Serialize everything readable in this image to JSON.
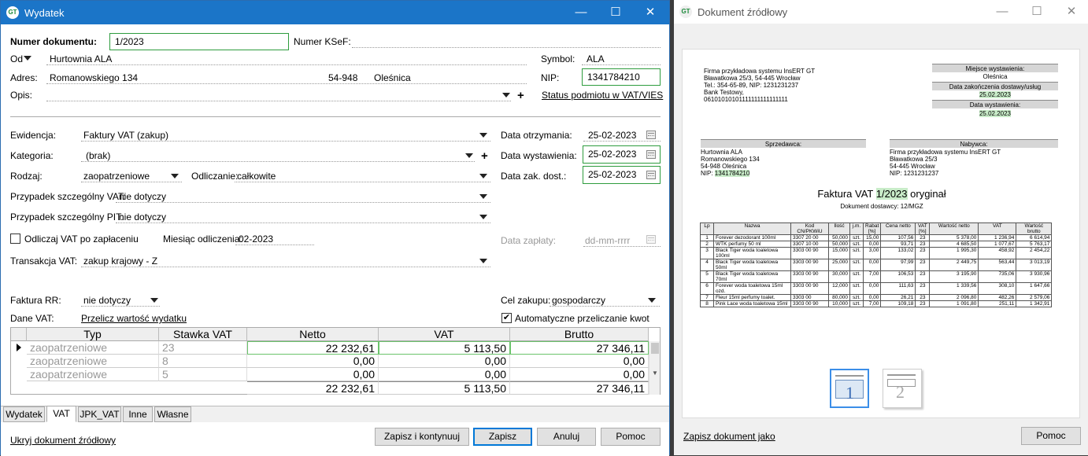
{
  "win1": {
    "title": "Wydatek",
    "minimize": "—",
    "maximize": "☐",
    "close": "✕"
  },
  "form": {
    "numer_label": "Numer dokumentu:",
    "numer": "1/2023",
    "ksef_label": "Numer KSeF:",
    "ksef": "",
    "od_label": "Od",
    "od": "Hurtownia ALA",
    "symbol_label": "Symbol:",
    "symbol": "ALA",
    "adres_label": "Adres:",
    "adres": "Romanowskiego 134",
    "kod": "54-948",
    "miasto": "Oleśnica",
    "nip_label": "NIP:",
    "nip": "1341784210",
    "opis_label": "Opis:",
    "opis": "",
    "status_link": "Status podmiotu w VAT/VIES",
    "ewidencja_label": "Ewidencja:",
    "ewidencja": "Faktury VAT (zakup)",
    "kategoria_label": "Kategoria:",
    "kategoria": "(brak)",
    "rodzaj_label": "Rodzaj:",
    "rodzaj": "zaopatrzeniowe",
    "odliczanie_label": "Odliczanie:",
    "odliczanie": "całkowite",
    "psvat_label": "Przypadek szczególny VAT:",
    "psvat": "nie dotyczy",
    "pspit_label": "Przypadek szczególny PIT:",
    "pspit": "nie dotyczy",
    "odliczaj_label": "Odliczaj VAT po zapłaceniu",
    "miesiac_label": "Miesiąc odliczenia:",
    "miesiac": "02-2023",
    "transakcja_label": "Transakcja VAT:",
    "transakcja": "zakup krajowy - Z",
    "data_otrz_label": "Data otrzymania:",
    "data_otrz": "25-02-2023",
    "data_wyst_label": "Data wystawienia:",
    "data_wyst": "25-02-2023",
    "data_zak_label": "Data zak. dost.:",
    "data_zak": "25-02-2023",
    "data_zap_label": "Data zapłaty:",
    "data_zap": "dd-mm-rrrr",
    "rr_label": "Faktura RR:",
    "rr": "nie dotyczy",
    "cel_label": "Cel zakupu:",
    "cel": "gospodarczy",
    "dane_vat_label": "Dane VAT:",
    "przelicz_link": "Przelicz wartość wydatku",
    "auto_label": "Automatyczne przeliczanie kwot",
    "auto_check": "✔"
  },
  "grid": {
    "headers": [
      "Typ",
      "Stawka VAT",
      "Netto",
      "VAT",
      "Brutto"
    ],
    "rows": [
      {
        "typ": "zaopatrzeniowe",
        "stawka": "23",
        "netto": "22 232,61",
        "vat": "5 113,50",
        "brutto": "27 346,11"
      },
      {
        "typ": "zaopatrzeniowe",
        "stawka": "8",
        "netto": "0,00",
        "vat": "0,00",
        "brutto": "0,00"
      },
      {
        "typ": "zaopatrzeniowe",
        "stawka": "5",
        "netto": "0,00",
        "vat": "0,00",
        "brutto": "0,00"
      }
    ],
    "sum": {
      "netto": "22 232,61",
      "vat": "5 113,50",
      "brutto": "27 346,11"
    }
  },
  "tabs": [
    "Wydatek",
    "VAT",
    "JPK_VAT",
    "Inne",
    "Własne"
  ],
  "footer": {
    "hide_link": "Ukryj dokument źródłowy",
    "btn_save_continue": "Zapisz i kontynuuj",
    "btn_save": "Zapisz",
    "btn_cancel": "Anuluj",
    "btn_help": "Pomoc"
  },
  "win2": {
    "title": "Dokument źródłowy",
    "save_link": "Zapisz dokument jako",
    "btn_help": "Pomoc"
  },
  "doc": {
    "firm": [
      "Firma przykładowa systemu InsERT GT",
      "Bławatkowa 25/3, 54-445 Wrocław",
      "Tel.: 354-65-89, NIP: 1231231237",
      "Bank Testowy,",
      "06101010101111111111111111"
    ],
    "place_h": "Miejsce wystawienia:",
    "place": "Oleśnica",
    "dz_h": "Data zakończenia dostawy/usług",
    "dz": "25.02.2023",
    "dw_h": "Data wystawienia:",
    "dw": "25.02.2023",
    "seller_h": "Sprzedawca:",
    "seller": [
      "Hurtownia ALA",
      "Romanowskiego 134",
      "54-948 Oleśnica"
    ],
    "seller_nip_label": "NIP:",
    "seller_nip": "1341784210",
    "buyer_h": "Nabywca:",
    "buyer": [
      "Firma przykładowa systemu InsERT GT",
      "Bławatkowa 25/3",
      "54-445 Wrocław",
      "NIP: 1231231237"
    ],
    "title_a": "Faktura VAT",
    "title_num": "1/2023",
    "title_b": "oryginał",
    "subtitle": "Dokument dostawcy: 12/MGZ",
    "cols": [
      "Lp",
      "Nazwa",
      "Kod CN/PKWiU",
      "Ilość",
      "j.m.",
      "Rabat [%]",
      "Cena netto",
      "VAT [%]",
      "Wartość netto",
      "VAT",
      "Wartość brutto"
    ],
    "items": [
      [
        "1",
        "Forever dezodorant 100ml",
        "3307 20 00",
        "50,000",
        "szt.",
        "15,00",
        "107,56",
        "23",
        "5 378,00",
        "1 236,94",
        "6 614,94"
      ],
      [
        "2",
        "WTK perfumy 50 ml",
        "3307 10 00",
        "50,000",
        "szt.",
        "0,00",
        "93,71",
        "23",
        "4 685,50",
        "1 077,67",
        "5 763,17"
      ],
      [
        "3",
        "Black Tiger woda toaletowa 100ml",
        "3303 00 90",
        "15,000",
        "szt.",
        "3,00",
        "133,02",
        "23",
        "1 995,30",
        "458,92",
        "2 454,22"
      ],
      [
        "4",
        "Black Tiger woda toaletowa 50ml",
        "3303 00 90",
        "25,000",
        "szt.",
        "0,00",
        "97,99",
        "23",
        "2 449,75",
        "563,44",
        "3 013,19"
      ],
      [
        "5",
        "Black Tiger woda toaletowa 70ml",
        "3303 00 90",
        "30,000",
        "szt.",
        "7,00",
        "106,53",
        "23",
        "3 195,90",
        "735,06",
        "3 930,96"
      ],
      [
        "6",
        "Forever woda toaletowa 15ml ozd.",
        "3303 00 90",
        "12,000",
        "szt.",
        "0,00",
        "111,63",
        "23",
        "1 339,56",
        "308,10",
        "1 647,66"
      ],
      [
        "7",
        "Fleur 15ml perfumy toalet.",
        "3303 00",
        "80,000",
        "szt.",
        "0,00",
        "26,21",
        "23",
        "2 096,80",
        "482,26",
        "2 579,06"
      ],
      [
        "8",
        "Pink Lace woda toaletowa 15ml",
        "3303 00 90",
        "10,000",
        "szt.",
        "7,00",
        "109,18",
        "23",
        "1 091,80",
        "251,11",
        "1 342,91"
      ]
    ],
    "thumb1": "1",
    "thumb2": "2"
  }
}
